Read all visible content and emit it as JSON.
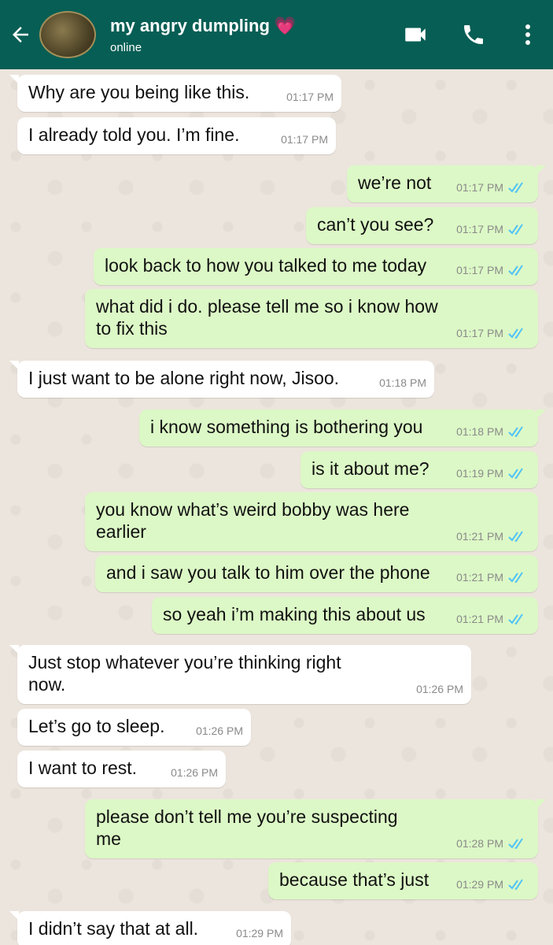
{
  "header": {
    "contact_name": "my angry dumpling",
    "heart": "💗",
    "status": "online",
    "icons": [
      "back-arrow-icon",
      "video-call-icon",
      "phone-icon",
      "more-options-icon"
    ],
    "background_color": "#075e54"
  },
  "colors": {
    "incoming": "#ffffff",
    "outgoing": "#dcf8c6",
    "read_ticks": "#4fc3f7"
  },
  "messages": [
    {
      "dir": "in",
      "text": "Why are you being like this.",
      "time": "01:17 PM"
    },
    {
      "dir": "in",
      "text": "I already told you. I’m fine.",
      "time": "01:17 PM"
    },
    {
      "dir": "out",
      "text": "we’re not",
      "time": "01:17 PM",
      "read": true
    },
    {
      "dir": "out",
      "text": "can’t you see?",
      "time": "01:17 PM",
      "read": true
    },
    {
      "dir": "out",
      "text": "look back to how you talked to me today",
      "time": "01:17 PM",
      "read": true
    },
    {
      "dir": "out",
      "text": "what did i do. please tell me so i know how to fix this",
      "time": "01:17 PM",
      "read": true
    },
    {
      "dir": "in",
      "text": "I just want to be alone right now, Jisoo.",
      "time": "01:18 PM"
    },
    {
      "dir": "out",
      "text": "i know something is bothering you",
      "time": "01:18 PM",
      "read": true
    },
    {
      "dir": "out",
      "text": "is it about me?",
      "time": "01:19 PM",
      "read": true
    },
    {
      "dir": "out",
      "text": "you know what’s weird bobby was here earlier",
      "time": "01:21 PM",
      "read": true
    },
    {
      "dir": "out",
      "text": "and i saw you talk to him over the phone",
      "time": "01:21 PM",
      "read": true
    },
    {
      "dir": "out",
      "text": "so yeah i’m making this about us",
      "time": "01:21 PM",
      "read": true
    },
    {
      "dir": "in",
      "text": "Just stop whatever you’re thinking right now.",
      "time": "01:26 PM"
    },
    {
      "dir": "in",
      "text": "Let’s go to sleep.",
      "time": "01:26 PM"
    },
    {
      "dir": "in",
      "text": "I want to rest.",
      "time": "01:26 PM"
    },
    {
      "dir": "out",
      "text": "please don’t tell me you’re suspecting me",
      "time": "01:28 PM",
      "read": true
    },
    {
      "dir": "out",
      "text": "because that’s just",
      "time": "01:29 PM",
      "read": true
    },
    {
      "dir": "in",
      "text": "I didn’t say that at all.",
      "time": "01:29 PM"
    }
  ]
}
